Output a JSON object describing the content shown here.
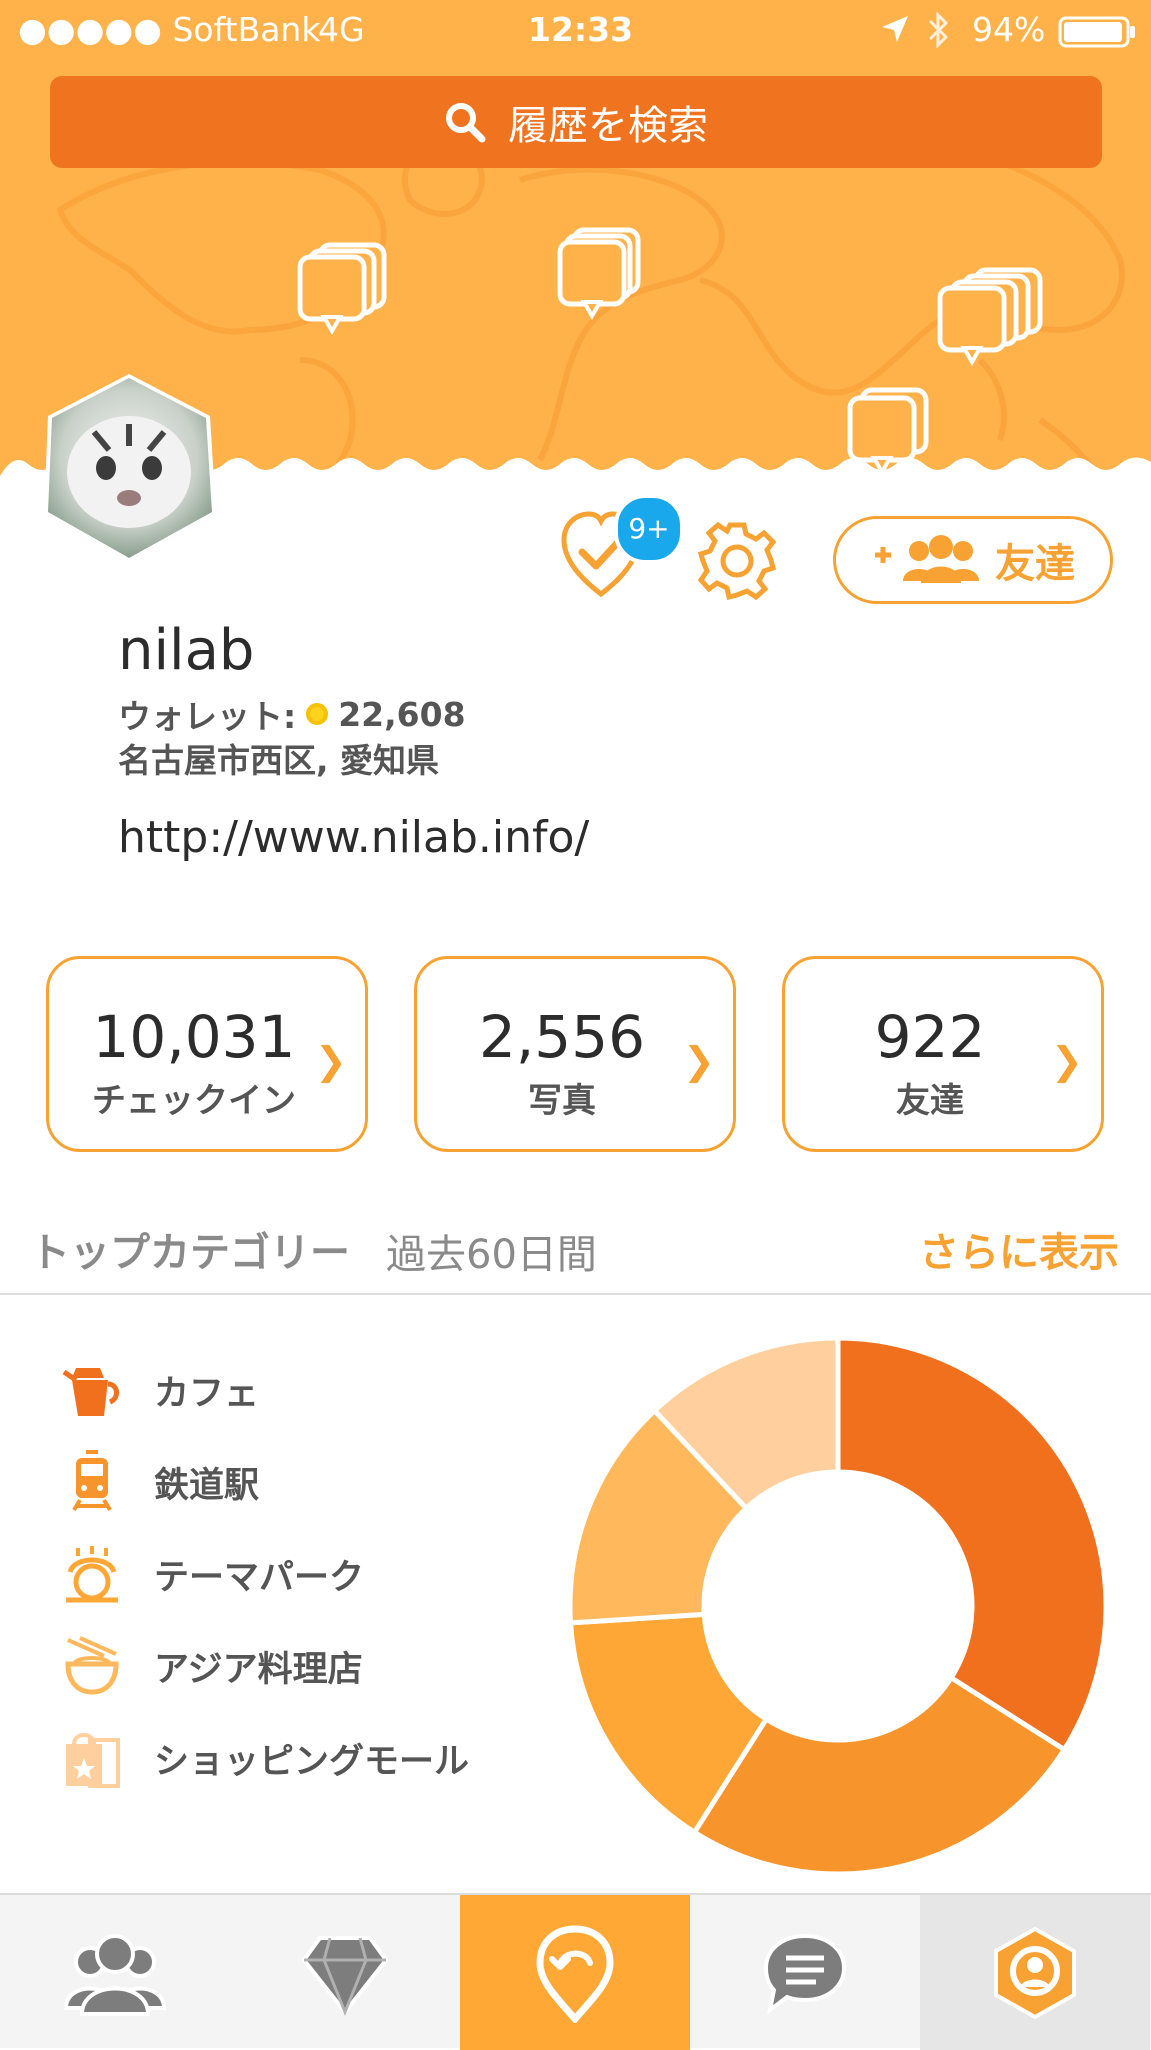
{
  "status_bar": {
    "carrier": "●●●●● SoftBank",
    "network": "4G",
    "time": "12:33",
    "battery": "94%"
  },
  "search": {
    "placeholder": "履歴を検索"
  },
  "profile": {
    "notification_badge": "9+",
    "friends_button": "友達",
    "username": "nilab",
    "wallet_label": "ウォレット:",
    "wallet_value": "22,608",
    "location": "名古屋市西区, 愛知県",
    "website": "http://www.nilab.info/"
  },
  "stats": [
    {
      "value": "10,031",
      "label": "チェックイン"
    },
    {
      "value": "2,556",
      "label": "写真"
    },
    {
      "value": "922",
      "label": "友達"
    }
  ],
  "top_category": {
    "title": "トップカテゴリー",
    "period": "過去60日間",
    "show_more": "さらに表示",
    "items": [
      {
        "label": "カフェ",
        "icon": "coffee-pot-icon",
        "color": "#f0701e"
      },
      {
        "label": "鉄道駅",
        "icon": "train-icon",
        "color": "#f7952c"
      },
      {
        "label": "テーマパーク",
        "icon": "theme-park-icon",
        "color": "#ffa736"
      },
      {
        "label": "アジア料理店",
        "icon": "rice-bowl-icon",
        "color": "#ffb85c"
      },
      {
        "label": "ショッピングモール",
        "icon": "shopping-bag-icon",
        "color": "#ffd09e"
      }
    ]
  },
  "chart_data": {
    "type": "pie",
    "categories": [
      "カフェ",
      "鉄道駅",
      "テーマパーク",
      "アジア料理店",
      "ショッピングモール"
    ],
    "values": [
      34,
      25,
      15,
      14,
      12
    ],
    "colors": [
      "#f0701e",
      "#f7952c",
      "#ffa736",
      "#ffb85c",
      "#ffd09e"
    ]
  },
  "bottom_nav": [
    {
      "name": "friends",
      "icon": "people-icon"
    },
    {
      "name": "lists",
      "icon": "diamond-icon"
    },
    {
      "name": "checkin",
      "icon": "checkin-pin-icon",
      "active": true
    },
    {
      "name": "messages",
      "icon": "chat-bubble-icon"
    },
    {
      "name": "profile",
      "icon": "profile-icon"
    }
  ]
}
